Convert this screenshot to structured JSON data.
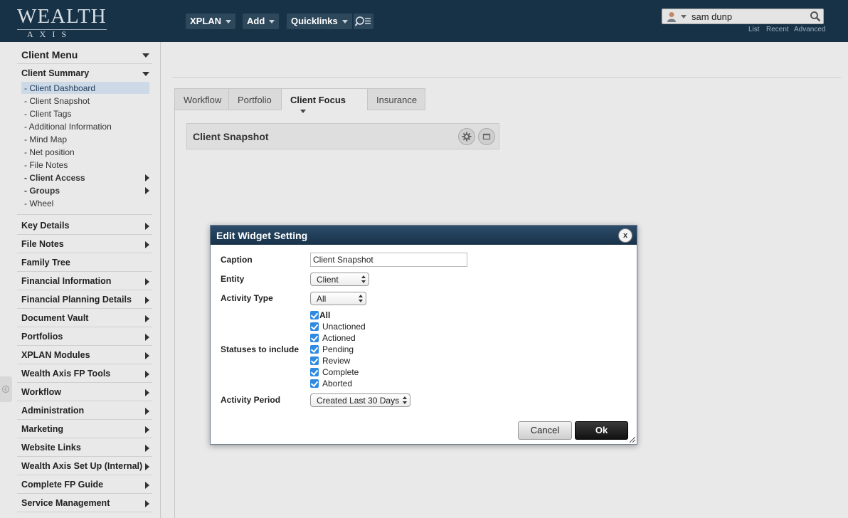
{
  "header": {
    "logo_top": "WEALTH",
    "logo_bottom": "AXIS",
    "nav": [
      {
        "label": "XPLAN"
      },
      {
        "label": "Add"
      },
      {
        "label": "Quicklinks"
      }
    ],
    "search_value": "sam dunp",
    "links": [
      "List",
      "Recent",
      "Advanced"
    ]
  },
  "sidebar": {
    "menu_title": "Client Menu",
    "client_summary": "Client Summary",
    "sub_items": [
      "- Client Dashboard",
      "- Client Snapshot",
      "- Client Tags",
      "- Additional Information",
      "- Mind Map",
      "- Net position",
      "- File Notes",
      "- Client Access",
      "- Groups",
      "- Wheel"
    ],
    "sections": [
      "Key Details",
      "File Notes",
      "Family Tree",
      "Financial Information",
      "Financial Planning Details",
      "Document Vault",
      "Portfolios",
      "XPLAN Modules",
      "Wealth Axis FP Tools",
      "Workflow",
      "Administration",
      "Marketing",
      "Website Links",
      "Wealth Axis Set Up (Internal)",
      "Complete FP Guide",
      "Service Management"
    ]
  },
  "tabs": [
    "Workflow",
    "Portfolio",
    "Client Focus",
    "Insurance"
  ],
  "widget": {
    "title": "Client Snapshot"
  },
  "dialog": {
    "title": "Edit Widget Setting",
    "close": "x",
    "caption_label": "Caption",
    "caption_value": "Client Snapshot",
    "entity_label": "Entity",
    "entity_value": "Client",
    "activity_type_label": "Activity Type",
    "activity_type_value": "All",
    "statuses_label": "Statuses to include",
    "statuses": [
      "All",
      "Unactioned",
      "Actioned",
      "Pending",
      "Review",
      "Complete",
      "Aborted"
    ],
    "activity_period_label": "Activity Period",
    "activity_period_value": "Created Last 30 Days",
    "cancel": "Cancel",
    "ok": "Ok"
  }
}
